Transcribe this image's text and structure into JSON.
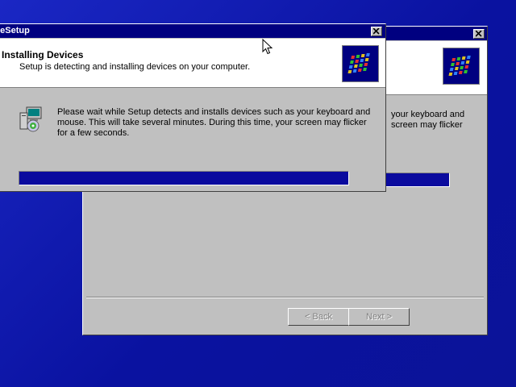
{
  "main_window": {
    "title": "Setup",
    "header_title": "Installing Devices",
    "header_subtitle": "Setup is detecting and installing devices on your computer.",
    "message_lines": [
      "Please wait while Setup detects and installs devices such as your keyboard and",
      "mouse.  This will take several minutes.  During this time, your screen may flicker",
      "for a few seconds."
    ],
    "progress_fraction": 1.0,
    "logo_icon": "windows-logo-icon",
    "setup_icon": "computer-cd-icon"
  },
  "back_window": {
    "partial_lines": [
      "your keyboard and",
      "screen may flicker"
    ],
    "back_button_label": "< Back",
    "next_button_label": "Next >",
    "progress_fraction": 1.0
  },
  "colors": {
    "desktop": "#0c14a8",
    "titlebar": "#000080",
    "progress": "#0a0a9e",
    "window": "#c0c0c0"
  },
  "cursor_icon": "arrow-cursor-icon"
}
